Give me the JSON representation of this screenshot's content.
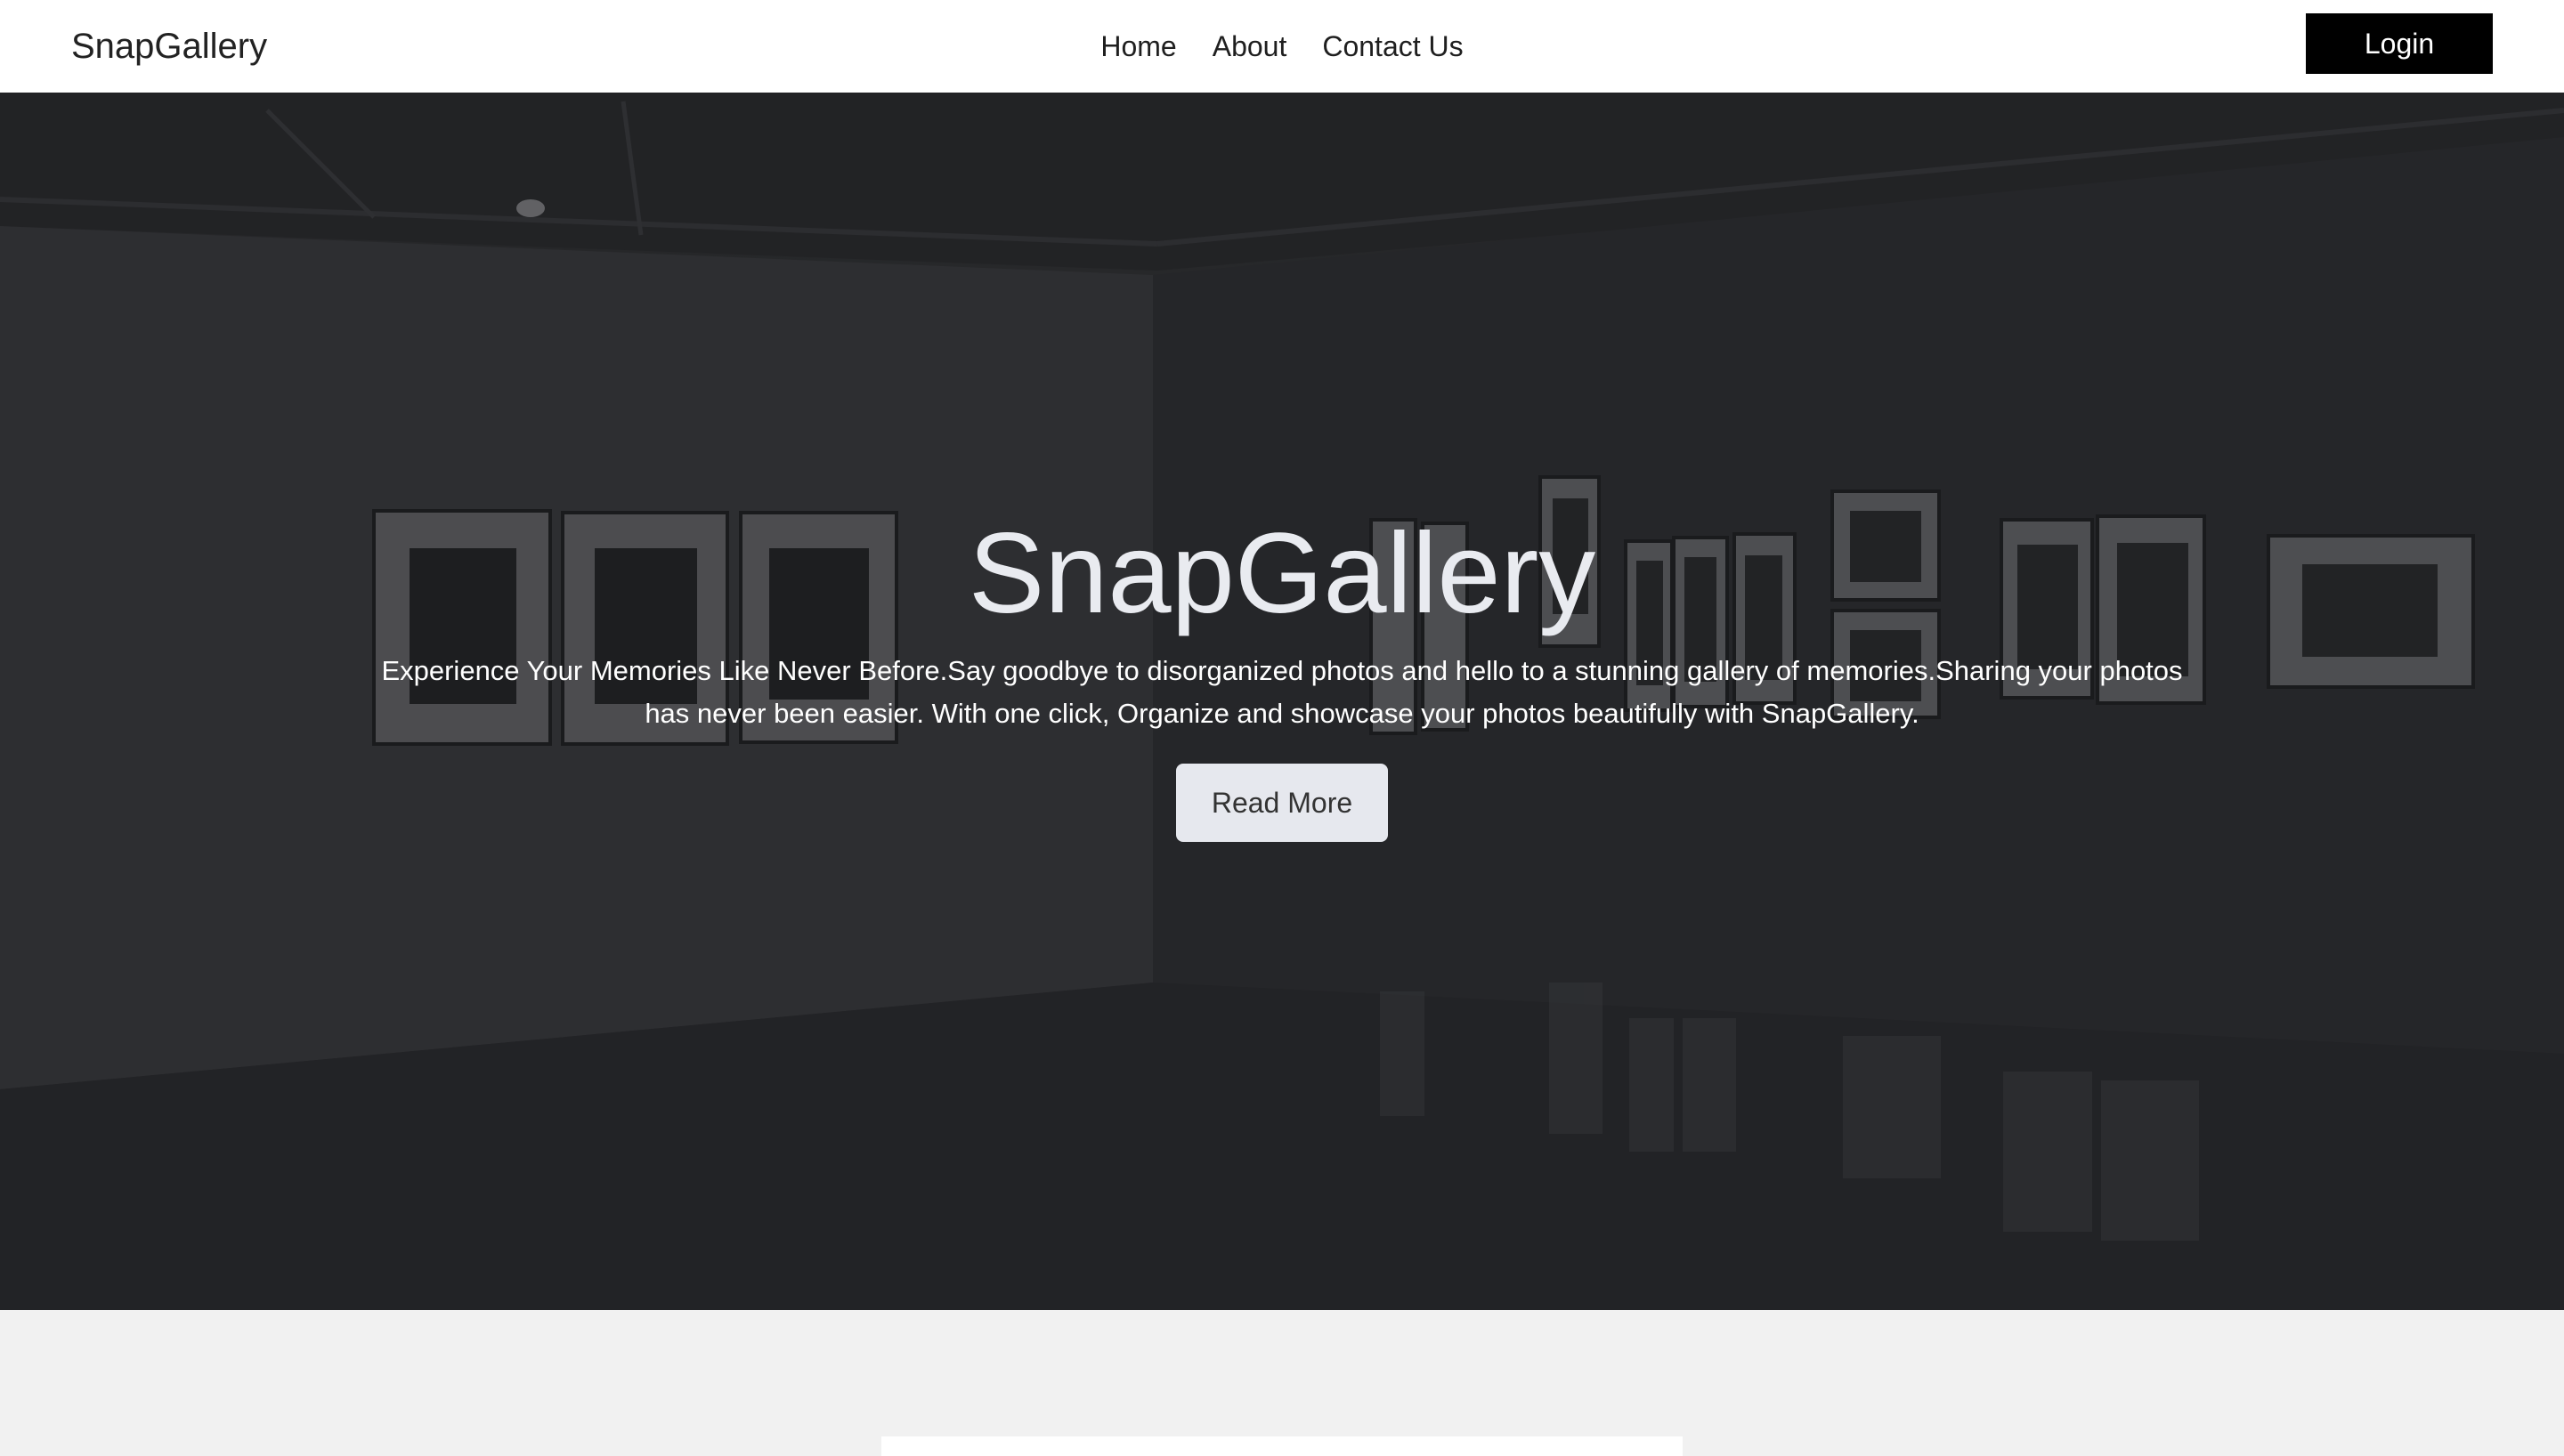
{
  "navbar": {
    "brand": "SnapGallery",
    "links": [
      "Home",
      "About",
      "Contact Us"
    ],
    "login_label": "Login"
  },
  "hero": {
    "title": "SnapGallery",
    "text": "Experience Your Memories Like Never Before.Say goodbye to disorganized photos and hello to a stunning gallery of memories.Sharing your photos has never been easier. With one click, Organize and showcase your photos beautifully with SnapGallery.",
    "button_label": "Read More"
  },
  "colors": {
    "navbar_bg": "#ffffff",
    "login_bg": "#000000",
    "hero_title": "#e9ebf0",
    "button_bg": "#e6e8ee",
    "page_bg": "#f1f1f1"
  }
}
